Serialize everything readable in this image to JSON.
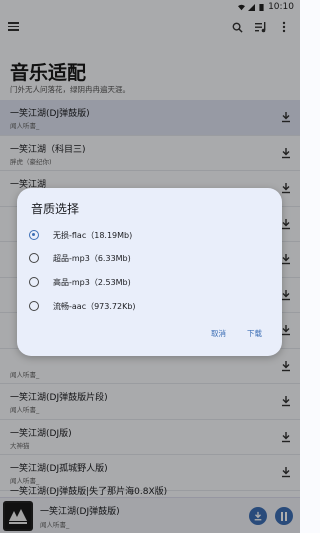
{
  "status": {
    "time": "10:10"
  },
  "page": {
    "title": "音乐适配",
    "subtitle": "门外无人问落花，绿阴冉冉遍天涯。"
  },
  "songs": [
    {
      "title": "一笑江湖(DJ弹鼓版)",
      "artist": "闻人听書_"
    },
    {
      "title": "一笑江湖（科目三)",
      "artist": "胖虎（豪纪你)"
    },
    {
      "title": "一笑江湖",
      "artist": ""
    },
    {
      "title": "",
      "artist": ""
    },
    {
      "title": "",
      "artist": ""
    },
    {
      "title": "",
      "artist": ""
    },
    {
      "title": "",
      "artist": ""
    },
    {
      "title": "",
      "artist": "闻人听書_"
    },
    {
      "title": "一笑江湖(DJ弹鼓版片段)",
      "artist": "闻人听書_"
    },
    {
      "title": "一笑江湖(DJ版)",
      "artist": "大神猫"
    },
    {
      "title": "一笑江湖(DJ孤城野人版)",
      "artist": "闻人听書_"
    },
    {
      "title": "一笑江湖(DJ弹鼓版|失了那片海0.8X版)",
      "artist": "闻人听書_"
    }
  ],
  "player": {
    "title": "一笑江湖(DJ弹鼓版)",
    "artist": "闻人听書_"
  },
  "dialog": {
    "title": "音质选择",
    "options": [
      {
        "label": "无损-flac（18.19Mb)",
        "selected": true
      },
      {
        "label": "超品-mp3（6.33Mb)",
        "selected": false
      },
      {
        "label": "高品-mp3（2.53Mb)",
        "selected": false
      },
      {
        "label": "流畅-aac（973.72Kb)",
        "selected": false
      }
    ],
    "cancel": "取消",
    "confirm": "下载"
  },
  "colors": {
    "accent": "#3d6fb5",
    "dialog_bg": "#e9eefa",
    "selected_row": "#dfe4f2"
  }
}
